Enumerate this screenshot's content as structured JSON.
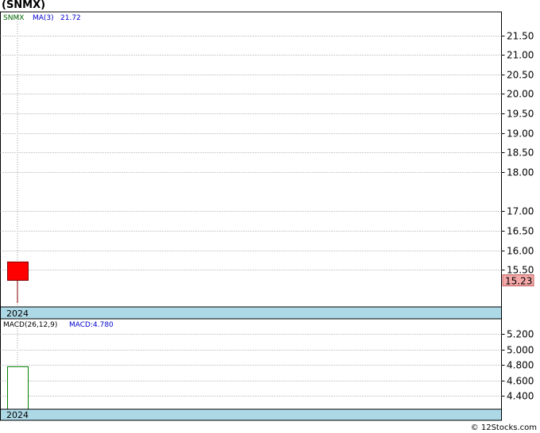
{
  "title": "(SNMX)",
  "credit": "© 12Stocks.com",
  "colors": {
    "down_candle": "#ff0000",
    "macd_bar": "#008000",
    "band": "#add8e6",
    "last_price_label": "#f4a8a8",
    "ticker_text": "#006400",
    "ma_text": "#0000cd",
    "grid": "#999999"
  },
  "chart_data": [
    {
      "type": "candlestick",
      "legend": {
        "ticker": "SNMX",
        "indicator": "MA(3)",
        "indicator_value": "21.72"
      },
      "ylim": [
        14.55,
        22.1
      ],
      "yticks": [
        "21.50",
        "21.00",
        "20.50",
        "20.00",
        "19.50",
        "19.00",
        "18.50",
        "18.00",
        "17.00",
        "16.50",
        "16.00",
        "15.50"
      ],
      "xlabel": "2024",
      "last_price": "15.23",
      "candles": [
        {
          "open": 15.7,
          "high": 15.7,
          "low": 14.65,
          "close": 15.23
        }
      ]
    },
    {
      "type": "bar",
      "legend": {
        "indicator": "MACD(26,12,9)",
        "value_label": "MACD:4.780"
      },
      "ylim": [
        4.23,
        5.4
      ],
      "yticks": [
        "5.200",
        "5.000",
        "4.800",
        "4.600",
        "4.400"
      ],
      "xlabel": "2024",
      "values": [
        4.78
      ]
    }
  ]
}
